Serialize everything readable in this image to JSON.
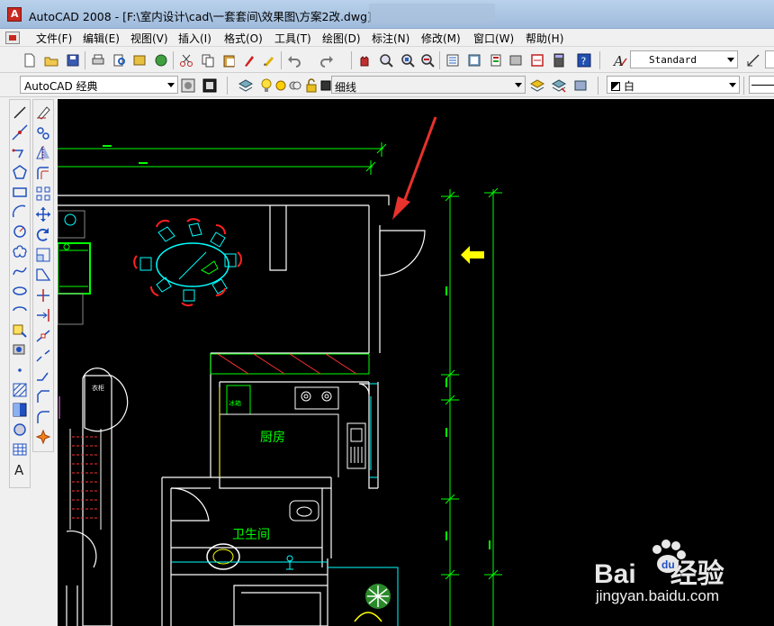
{
  "window": {
    "title": "AutoCAD 2008 - [F:\\室内设计\\cad\\一套套间\\效果图\\方案2改.dwg]"
  },
  "menubar": {
    "items": [
      "文件(F)",
      "编辑(E)",
      "视图(V)",
      "插入(I)",
      "格式(O)",
      "工具(T)",
      "绘图(D)",
      "标注(N)",
      "修改(M)",
      "窗口(W)",
      "帮助(H)"
    ]
  },
  "toolbar_styles": {
    "text_style": "Standard"
  },
  "toolbar_workspace": {
    "workspace": "AutoCAD 经典",
    "layer": "细线",
    "color": "白"
  },
  "drawing": {
    "labels": {
      "kitchen": "厨房",
      "bathroom": "卫生间",
      "fridge": "冰箱",
      "closet": "衣柜"
    },
    "colors": {
      "background": "#000000",
      "walls": "#ffffff",
      "dimensions": "#00ff00",
      "furniture": "#00ffff",
      "arrow": "#e8322c",
      "marker": "#ffff00"
    }
  },
  "icons": {
    "draw_toolbar": [
      "line-icon",
      "construction-line-icon",
      "polyline-icon",
      "polygon-icon",
      "rectangle-icon",
      "arc-icon",
      "circle-icon",
      "revision-cloud-icon",
      "spline-icon",
      "ellipse-icon",
      "ellipse-arc-icon",
      "insert-block-icon",
      "make-block-icon",
      "point-icon",
      "hatch-icon",
      "gradient-icon",
      "region-icon",
      "table-icon",
      "multiline-text-icon"
    ],
    "modify_toolbar": [
      "erase-icon",
      "copy-icon",
      "mirror-icon",
      "offset-icon",
      "array-icon",
      "move-icon",
      "rotate-icon",
      "scale-icon",
      "stretch-icon",
      "trim-icon",
      "extend-icon",
      "break-at-point-icon",
      "break-icon",
      "join-icon",
      "chamfer-icon",
      "fillet-icon",
      "explode-icon"
    ]
  },
  "watermark": {
    "brand": "Bai",
    "brand2": "经验",
    "url": "jingyan.baidu.com"
  }
}
